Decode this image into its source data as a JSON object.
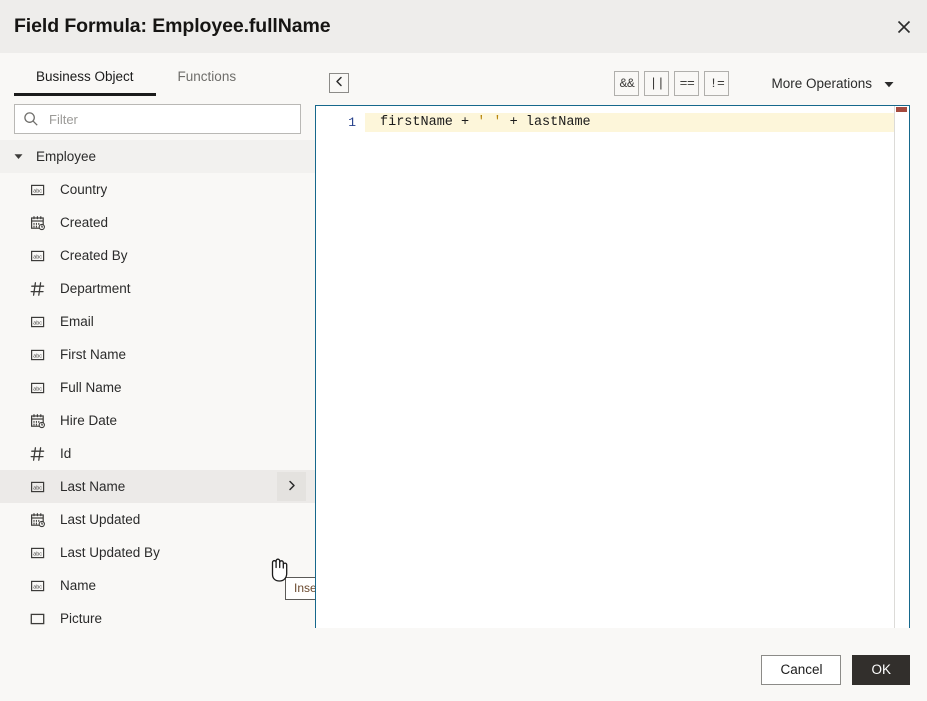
{
  "dialog": {
    "title": "Field Formula: Employee.fullName",
    "close_icon": "close-icon"
  },
  "left_panel": {
    "tabs": [
      {
        "label": "Business Object",
        "active": true
      },
      {
        "label": "Functions",
        "active": false
      }
    ],
    "filter": {
      "placeholder": "Filter",
      "value": "",
      "icon": "search-icon"
    },
    "tree": {
      "group": {
        "label": "Employee",
        "expanded": true,
        "caret_icon": "caret-down-icon"
      },
      "items": [
        {
          "label": "Country",
          "icon": "text-field-icon"
        },
        {
          "label": "Created",
          "icon": "datetime-field-icon"
        },
        {
          "label": "Created By",
          "icon": "text-field-icon"
        },
        {
          "label": "Department",
          "icon": "number-field-icon"
        },
        {
          "label": "Email",
          "icon": "text-field-icon"
        },
        {
          "label": "First Name",
          "icon": "text-field-icon"
        },
        {
          "label": "Full Name",
          "icon": "text-field-icon"
        },
        {
          "label": "Hire Date",
          "icon": "datetime-field-icon"
        },
        {
          "label": "Id",
          "icon": "number-field-icon"
        },
        {
          "label": "Last Name",
          "icon": "text-field-icon",
          "hovered": true
        },
        {
          "label": "Last Updated",
          "icon": "datetime-field-icon"
        },
        {
          "label": "Last Updated By",
          "icon": "text-field-icon"
        },
        {
          "label": "Name",
          "icon": "text-field-icon"
        },
        {
          "label": "Picture",
          "icon": "image-field-icon"
        }
      ],
      "insert_button": {
        "icon": "chevron-right-icon",
        "tooltip": "Insert"
      }
    }
  },
  "editor_toolbar": {
    "collapse_button": {
      "icon": "chevron-left-icon"
    },
    "operators": [
      {
        "label": "&&",
        "name": "and-operator-button"
      },
      {
        "label": "||",
        "name": "or-operator-button"
      },
      {
        "label": "==",
        "name": "equals-operator-button"
      },
      {
        "label": "!=",
        "name": "not-equals-operator-button"
      }
    ],
    "more_operations": {
      "label": "More Operations",
      "icon": "chevron-down-icon"
    }
  },
  "editor": {
    "line_number": "1",
    "code": {
      "part1": "firstName ",
      "op1": "+ ",
      "string": "' '",
      "op2": " + ",
      "part2": "lastName"
    },
    "annotation_marker": true
  },
  "footer": {
    "cancel_label": "Cancel",
    "ok_label": "OK"
  },
  "colors": {
    "header_bg": "#eeedeb",
    "body_bg": "#f9f8f6",
    "editor_border": "#16688c",
    "active_line": "#fdf6da",
    "line_number": "#26408b",
    "string_token": "#b8860b",
    "primary_button": "#322f2c",
    "annotation": "#a44a3f",
    "tab_active_underline": "#1b1b1b"
  }
}
